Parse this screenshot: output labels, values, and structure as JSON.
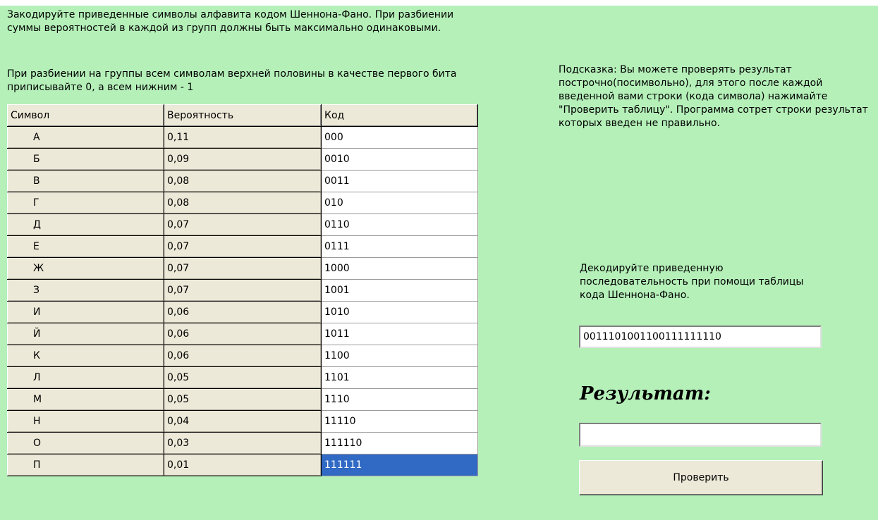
{
  "intro": {
    "text1": "Закодируйте приведенные символы алфавита кодом Шеннона-Фано. При разбиении суммы вероятностей в каждой из групп должны быть максимально одинаковыми.",
    "text2": "При разбиении на группы всем символам верхней половины в качестве первого бита приписывайте 0, а всем нижним - 1"
  },
  "table": {
    "headers": [
      "Символ",
      "Вероятность",
      "Код"
    ],
    "rows": [
      {
        "symbol": "А",
        "probability": "0,11",
        "code": "000"
      },
      {
        "symbol": "Б",
        "probability": "0,09",
        "code": "0010"
      },
      {
        "symbol": "В",
        "probability": "0,08",
        "code": "0011"
      },
      {
        "symbol": "Г",
        "probability": "0,08",
        "code": "010"
      },
      {
        "symbol": "Д",
        "probability": "0,07",
        "code": "0110"
      },
      {
        "symbol": "Е",
        "probability": "0,07",
        "code": "0111"
      },
      {
        "symbol": "Ж",
        "probability": "0,07",
        "code": "1000"
      },
      {
        "symbol": "З",
        "probability": "0,07",
        "code": "1001"
      },
      {
        "symbol": "И",
        "probability": "0,06",
        "code": "1010"
      },
      {
        "symbol": "Й",
        "probability": "0,06",
        "code": "1011"
      },
      {
        "symbol": "К",
        "probability": "0,06",
        "code": "1100"
      },
      {
        "symbol": "Л",
        "probability": "0,05",
        "code": "1101"
      },
      {
        "symbol": "М",
        "probability": "0,05",
        "code": "1110"
      },
      {
        "symbol": "Н",
        "probability": "0,04",
        "code": "11110"
      },
      {
        "symbol": "О",
        "probability": "0,03",
        "code": "111110"
      },
      {
        "symbol": "П",
        "probability": "0,01",
        "code": "111111"
      }
    ],
    "selected_row": 15
  },
  "hint": {
    "text": "Подсказка: Вы можете проверять результат построчно(посимвольно), для этого после каждой введенной вами строки (кода символа) нажимайте \"Проверить таблицу\". Программа сотрет строки результат которых введен не правильно."
  },
  "decode": {
    "instruction": "Декодируйте приведенную последовательность при помощи таблицы кода Шеннона-Фано.",
    "sequence": "0011101001100111111110",
    "result_label": "Результат:",
    "result_value": "",
    "check_button": "Проверить"
  },
  "colors": {
    "background": "#b5f0b9",
    "selection": "#316ac5",
    "button_face": "#ece9d8"
  }
}
